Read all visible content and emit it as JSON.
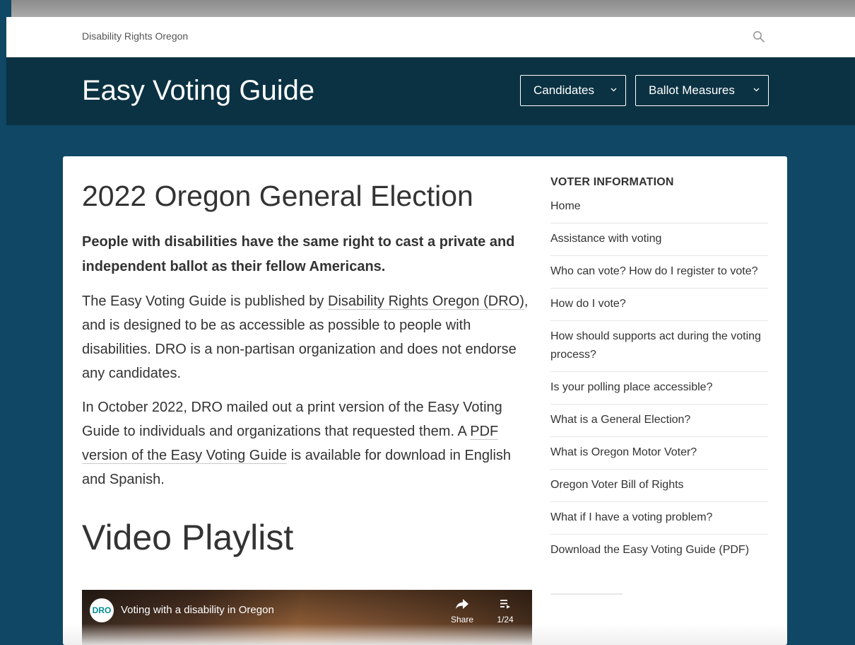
{
  "top_bar": {
    "site_name": "Disability Rights Oregon"
  },
  "header": {
    "title": "Easy Voting Guide",
    "nav": [
      {
        "label": "Candidates"
      },
      {
        "label": "Ballot Measures"
      }
    ]
  },
  "main": {
    "title": "2022 Oregon General Election",
    "lead": "People with disabilities have the same right to cast a private and independent ballot as their fellow Americans.",
    "para1": {
      "pre": "The Easy Voting Guide is published by ",
      "link": "Disability Rights Oregon (DRO)",
      "post": ", and is designed to be as accessible as possible to people with disabilities. DRO is a non-partisan organization and does not endorse any candidates."
    },
    "para2": {
      "pre": "In October 2022, DRO mailed out a print version of the Easy Voting Guide to individuals and organizations that requested them. A ",
      "link": "PDF version of the Easy Voting Guide",
      "post": " is available for download in English and Spanish."
    },
    "video_heading": "Video Playlist",
    "video": {
      "channel_logo": "DRO",
      "title": "Voting with a disability in Oregon",
      "share_label": "Share",
      "playlist_position": "1/24"
    }
  },
  "sidebar": {
    "heading": "VOTER INFORMATION",
    "items": [
      "Home",
      "Assistance with voting",
      "Who can vote? How do I register to vote?",
      "How do I vote?",
      "How should supports act during the voting process?",
      "Is your polling place accessible?",
      "What is a General Election?",
      "What is Oregon Motor Voter?",
      "Oregon Voter Bill of Rights",
      "What if I have a voting problem?",
      "Download the Easy Voting Guide (PDF)"
    ]
  },
  "colors": {
    "page_bg": "#0f4765",
    "header_bg": "#0b3243",
    "dro_teal": "#008c95"
  },
  "icons": [
    "search-icon",
    "chevron-down-icon",
    "share-icon",
    "playlist-icon"
  ]
}
